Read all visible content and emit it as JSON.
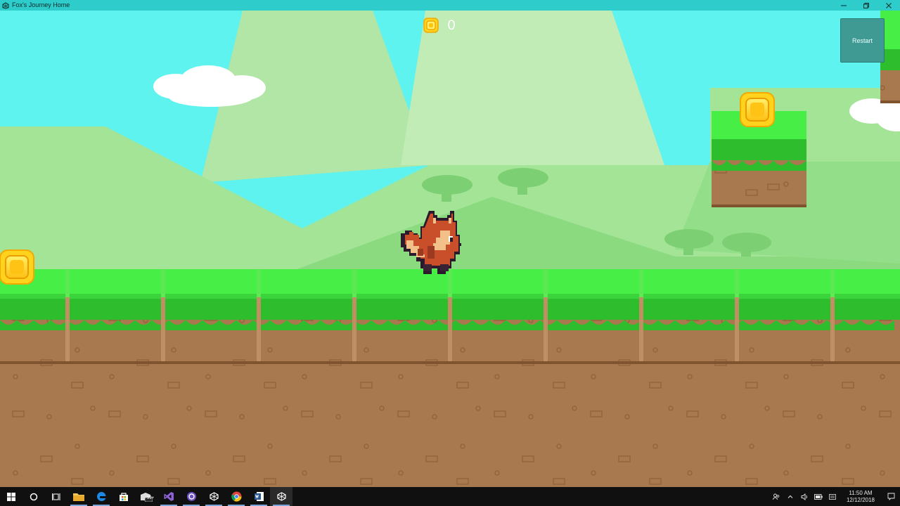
{
  "window": {
    "title": "Fox's Journey Home"
  },
  "hud": {
    "coin_count": "0",
    "restart_label": "Restart"
  },
  "colors": {
    "sky": "#5ef3ee",
    "grass_top": "#46ee46",
    "grass_dark": "#2dbd2d",
    "dirt": "#a8794f",
    "coin": "#ffd21e",
    "titlebar": "#2fcccc"
  },
  "taskbar": {
    "apps": [
      "windows-start-icon",
      "cortana-search-icon",
      "task-view-icon",
      "file-explorer-icon",
      "edge-icon",
      "store-icon",
      "mail-icon",
      "visual-studio-icon",
      "app-circle-icon",
      "unity-icon",
      "chrome-icon",
      "word-icon",
      "unity-active-icon"
    ],
    "mail_badge": "99+",
    "clock_time": "11:50 AM",
    "clock_date": "12/12/2018"
  }
}
